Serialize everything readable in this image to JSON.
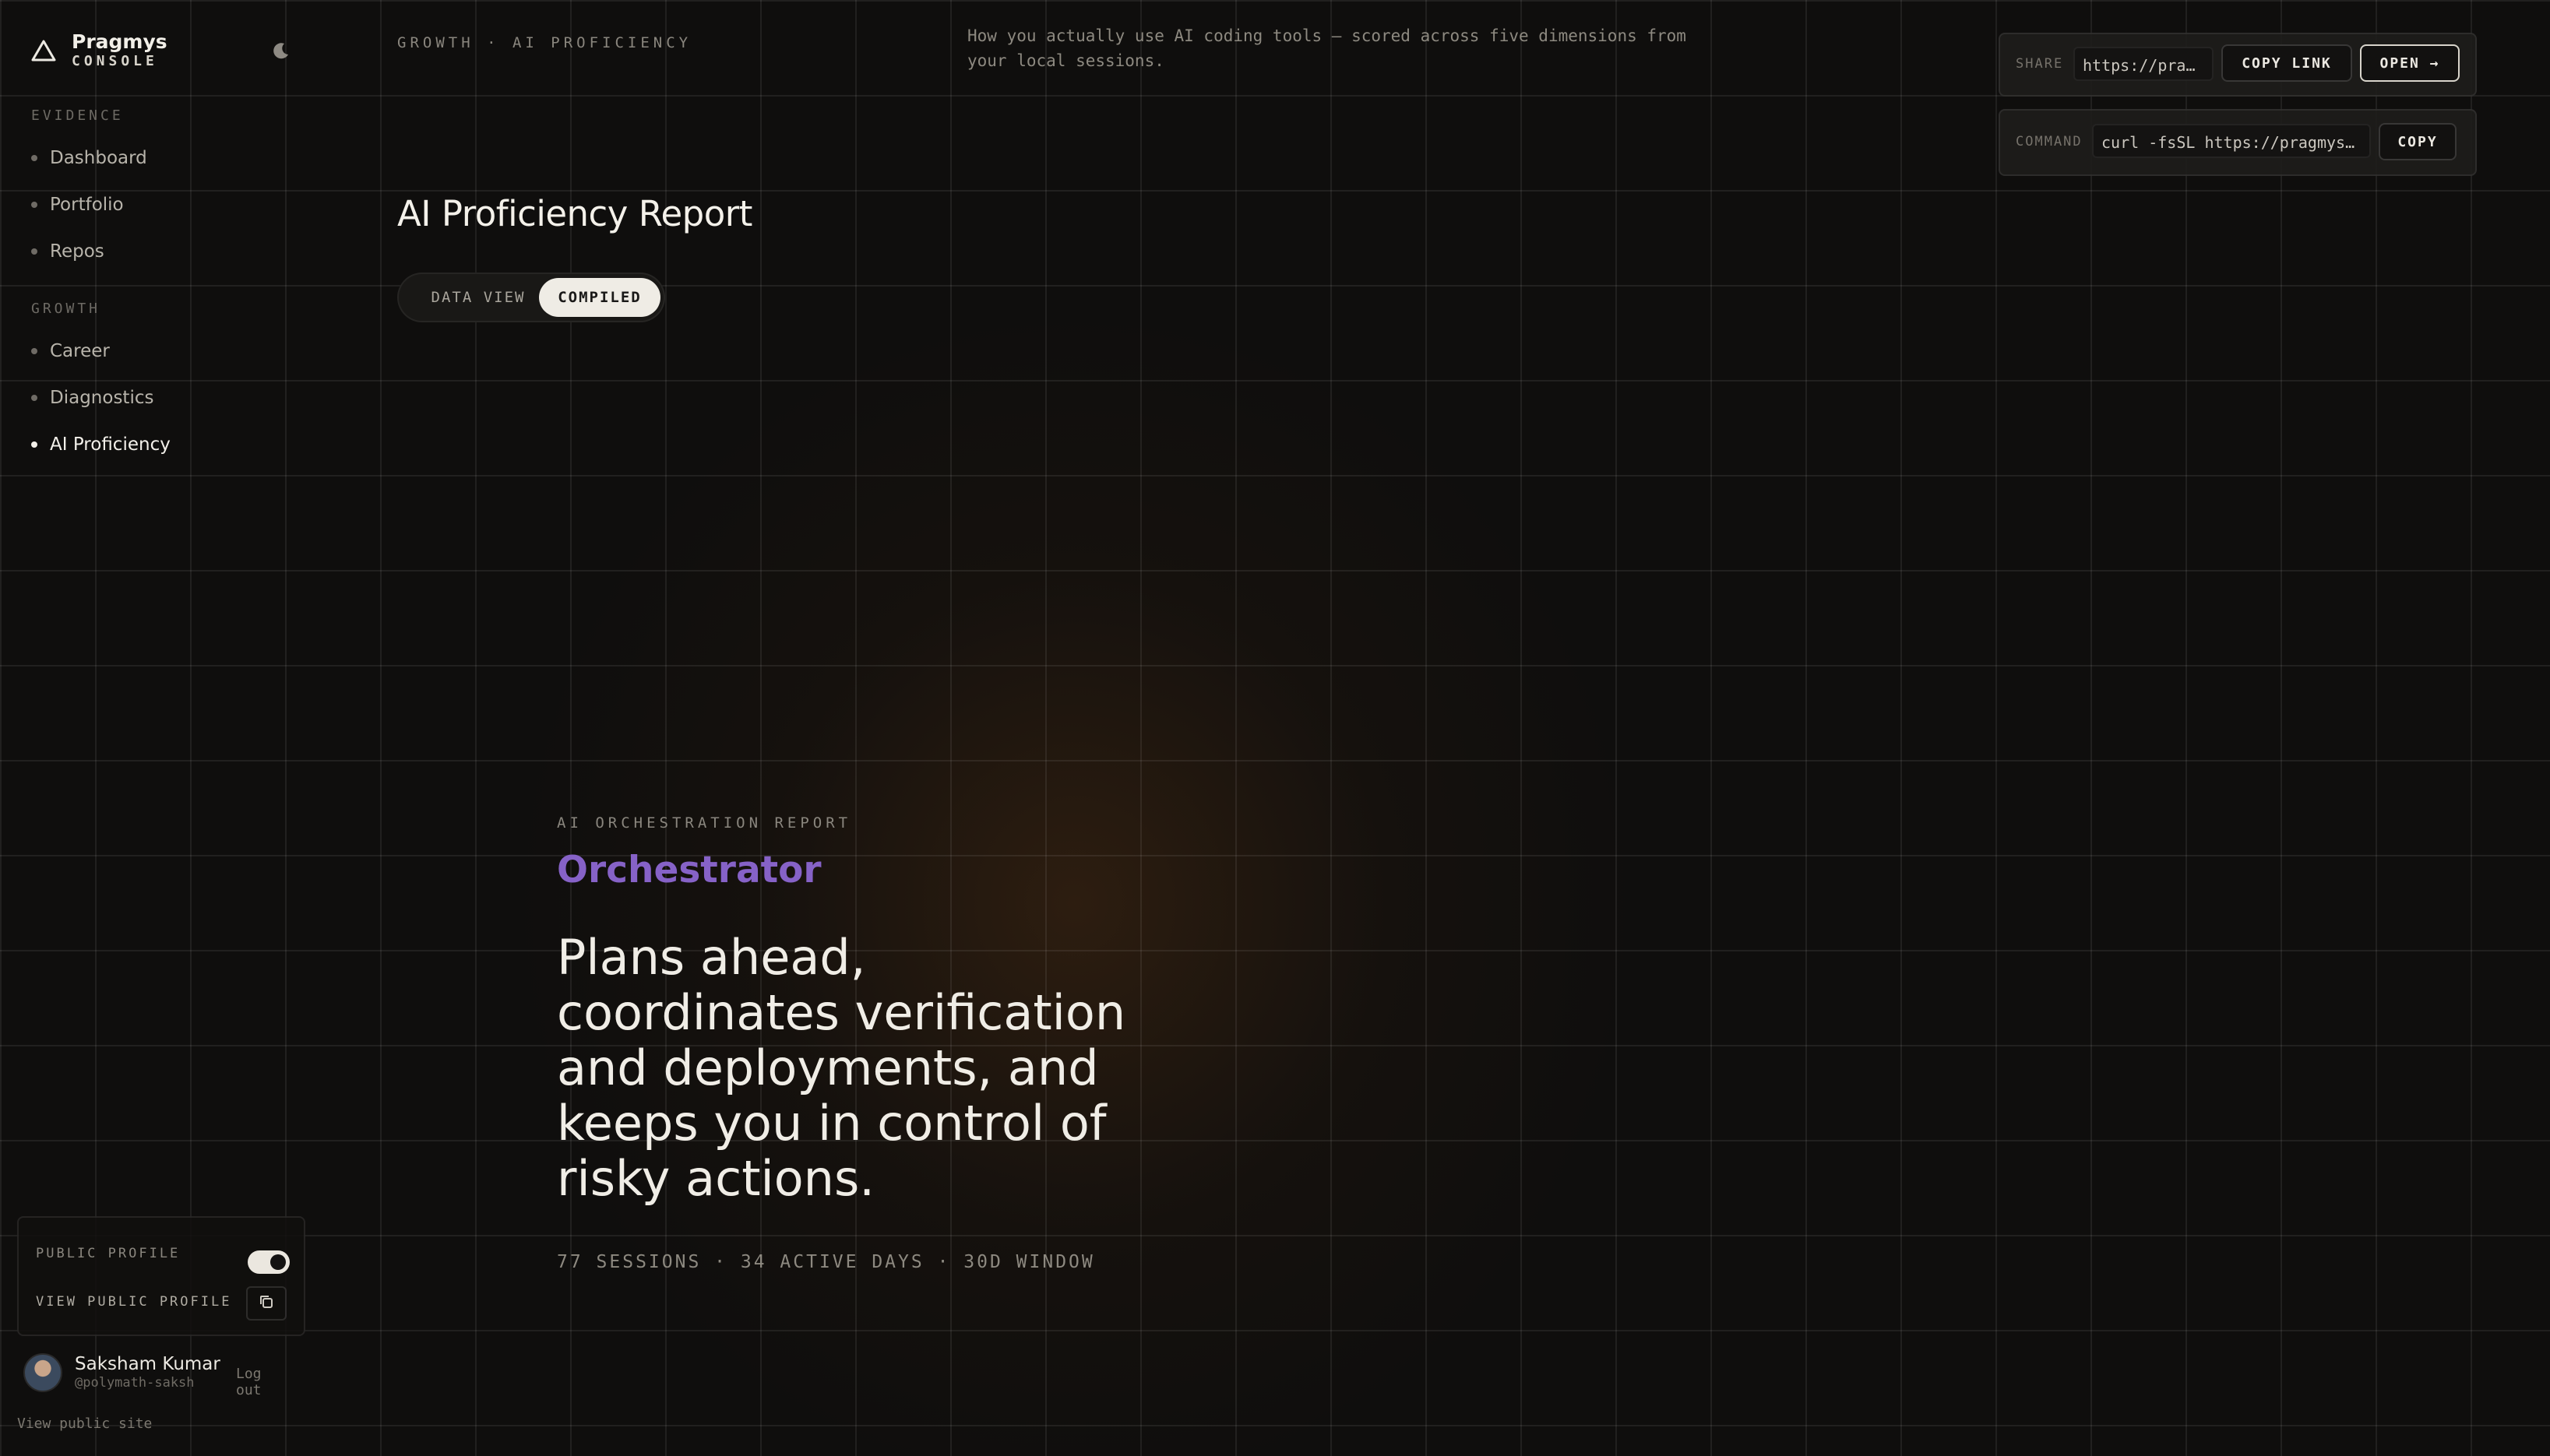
{
  "brand": {
    "name": "Pragmys",
    "sub": "CONSOLE"
  },
  "sidebar": {
    "sections": [
      {
        "title": "EVIDENCE",
        "items": [
          {
            "label": "Dashboard"
          },
          {
            "label": "Portfolio"
          },
          {
            "label": "Repos"
          }
        ]
      },
      {
        "title": "GROWTH",
        "items": [
          {
            "label": "Career"
          },
          {
            "label": "Diagnostics"
          },
          {
            "label": "AI Proficiency",
            "active": true
          }
        ]
      }
    ],
    "profile_card": {
      "public_profile_label": "PUBLIC PROFILE",
      "public_profile_enabled": true,
      "view_public_profile_label": "VIEW PUBLIC PROFILE"
    },
    "user": {
      "name": "Saksham Kumar",
      "handle": "@polymath-saksh",
      "logout_label": "Log out"
    },
    "view_public_site_label": "View public site"
  },
  "header": {
    "breadcrumb": "GROWTH · AI PROFICIENCY",
    "description": "How you actually use AI coding tools — scored across five dimensions from your local sessions.",
    "share": {
      "label": "SHARE",
      "url": "https://pragmys.dev/p/polymath-saksh/ai",
      "copy_link_label": "COPY LINK",
      "open_label": "OPEN →"
    },
    "command": {
      "label": "COMMAND",
      "value": "curl -fsSL https://pragmys.dev/install.sh | sh",
      "copy_label": "COPY"
    }
  },
  "main": {
    "title": "AI Proficiency Report",
    "view_toggle": {
      "options": [
        "DATA VIEW",
        "COMPILED"
      ],
      "selected": "COMPILED"
    },
    "report": {
      "eyebrow": "AI ORCHESTRATION REPORT",
      "type": "Orchestrator",
      "summary": "Plans ahead, coordinates verification and deployments, and keeps you in control of risky actions.",
      "stats": "77 SESSIONS · 34 ACTIVE DAYS · 30D WINDOW"
    }
  },
  "colors": {
    "background": "#0f0e0d",
    "accent_purple": "#8662c7",
    "text_primary": "#f0ede6",
    "text_muted": "#8d8980"
  },
  "icons": {
    "logo": "triangle-logo-icon",
    "theme": "moon-icon",
    "copy": "copy-icon",
    "user": "avatar"
  }
}
